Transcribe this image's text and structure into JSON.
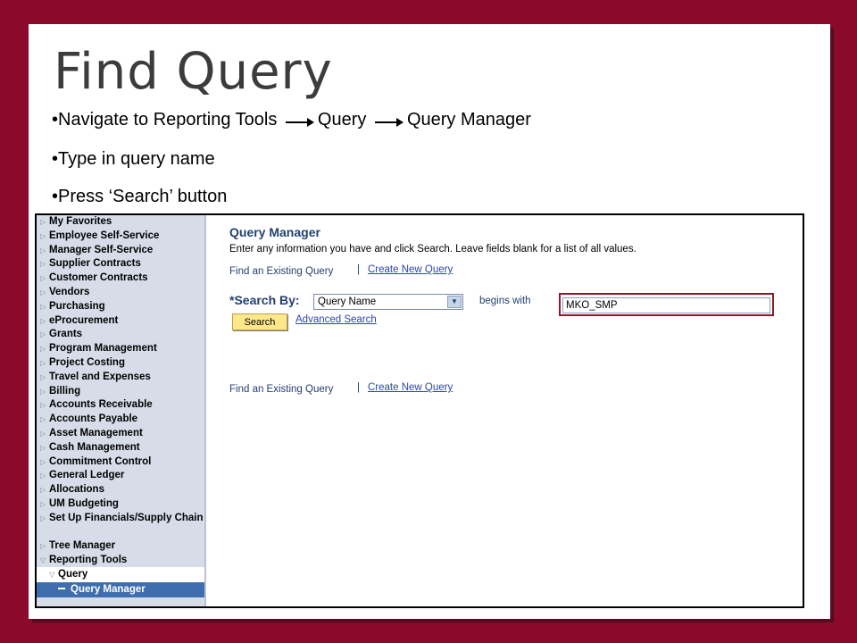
{
  "slide": {
    "title": "Find Query",
    "bullets": {
      "b1": {
        "prefix": "•Navigate to Reporting Tools",
        "part2": "Query",
        "part3": "Query Manager"
      },
      "b2": "•Type in query name",
      "b3": "•Press ‘Search’ button"
    }
  },
  "menu": {
    "items": [
      "My Favorites",
      "Employee Self-Service",
      "Manager Self-Service",
      "Supplier Contracts",
      "Customer Contracts",
      "Vendors",
      "Purchasing",
      "eProcurement",
      "Grants",
      "Program Management",
      "Project Costing",
      "Travel and Expenses",
      "Billing",
      "Accounts Receivable",
      "Accounts Payable",
      "Asset Management",
      "Cash Management",
      "Commitment Control",
      "General Ledger",
      "Allocations",
      "UM Budgeting"
    ],
    "setup": "Set Up Financials/Supply Chain",
    "tree": "Tree Manager",
    "reporting": "Reporting Tools",
    "query": "Query",
    "query_manager": "Query Manager"
  },
  "content": {
    "page_title": "Query Manager",
    "instructions": "Enter any information you have and click Search. Leave fields blank for a list of all values.",
    "find_existing": "Find an Existing Query",
    "separator": "|",
    "create_new": "Create New Query",
    "search_by_label": "*Search By:",
    "search_by_value": "Query Name",
    "begins_with": "begins with",
    "search_value": "MKO_SMP",
    "search_button": "Search",
    "advanced_search": "Advanced Search"
  },
  "colors": {
    "frame": "#8b0a2c",
    "menu_bg": "#d6dde8",
    "selected": "#3e6eae",
    "link": "#2a45b0",
    "heading": "#223f73",
    "button": "#ffe88a"
  }
}
